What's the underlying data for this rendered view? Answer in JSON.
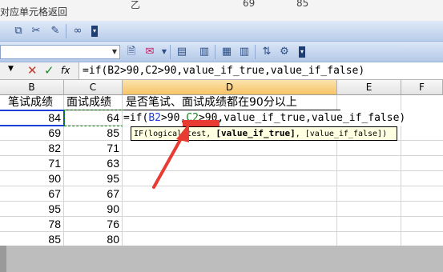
{
  "top_strip": {
    "tooltip_text": "对应单元格返回",
    "frag_letter": "乙",
    "frag_num1": "69",
    "frag_num2": "85"
  },
  "formula_bar": {
    "cancel_symbol": "✕",
    "enter_symbol": "✓",
    "insert_function_symbol": "fx",
    "formula": "=if(B2>90,C2>90,value_if_true,value_if_false)"
  },
  "columns": [
    "B",
    "C",
    "D",
    "E",
    "F"
  ],
  "active_column": "D",
  "headers": {
    "b": "笔试成绩",
    "c": "面试成绩",
    "d": "是否笔试、面试成绩都在90分以上"
  },
  "rows": [
    {
      "b": "84",
      "c": "64"
    },
    {
      "b": "69",
      "c": "85"
    },
    {
      "b": "82",
      "c": "71"
    },
    {
      "b": "71",
      "c": "63"
    },
    {
      "b": "90",
      "c": "95"
    },
    {
      "b": "67",
      "c": "67"
    },
    {
      "b": "95",
      "c": "90"
    },
    {
      "b": "78",
      "c": "76"
    },
    {
      "b": "85",
      "c": "80"
    }
  ],
  "cell_edit": {
    "prefix": "=if(",
    "ref_b2": "B2",
    "mid1": ">90,",
    "ref_c2": "C2",
    "suffix": ">90,value_if_true,value_if_false)"
  },
  "tooltip": {
    "prefix": "IF(logical_test, ",
    "current_arg": "[value_if_true]",
    "suffix": ", [value_if_false])"
  },
  "colors": {
    "ref_b2": "#1c3fd4",
    "ref_c2": "#118a18",
    "arrow": "#e83b32",
    "active_header": "#f7c466"
  }
}
